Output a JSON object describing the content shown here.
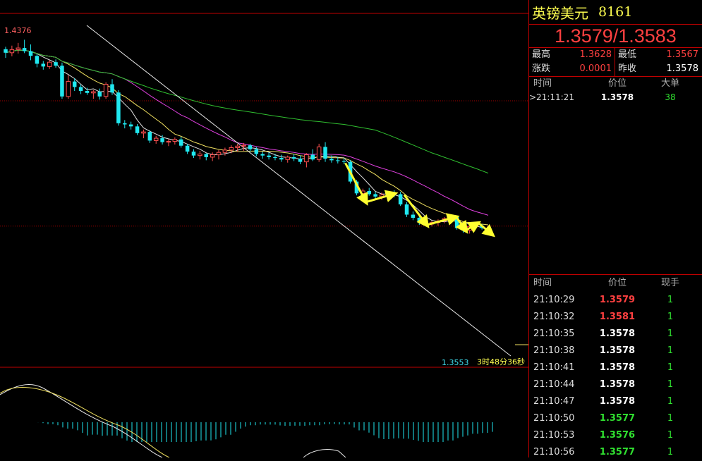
{
  "panel": {
    "name": "英镑美元",
    "code": "8161",
    "price": "1.3579/1.3583",
    "stats": {
      "high_label": "最高",
      "high": "1.3628",
      "low_label": "最低",
      "low": "1.3567",
      "change_label": "涨跌",
      "change": "0.0001",
      "prev_label": "昨收",
      "prev": "1.3578"
    },
    "big_orders": {
      "headers": [
        "时间",
        "价位",
        "大单"
      ],
      "rows": [
        {
          "time": ">21:11:21",
          "price": "1.3578",
          "qty": "38"
        }
      ]
    },
    "ticks": {
      "headers": [
        "时间",
        "价位",
        "现手"
      ],
      "rows": [
        {
          "time": "21:10:29",
          "price": "1.3579",
          "qty": "1",
          "color": "red"
        },
        {
          "time": "21:10:32",
          "price": "1.3581",
          "qty": "1",
          "color": "red"
        },
        {
          "time": "21:10:35",
          "price": "1.3578",
          "qty": "1",
          "color": "white"
        },
        {
          "time": "21:10:38",
          "price": "1.3578",
          "qty": "1",
          "color": "white"
        },
        {
          "time": "21:10:41",
          "price": "1.3578",
          "qty": "1",
          "color": "white"
        },
        {
          "time": "21:10:44",
          "price": "1.3578",
          "qty": "1",
          "color": "white"
        },
        {
          "time": "21:10:47",
          "price": "1.3578",
          "qty": "1",
          "color": "white"
        },
        {
          "time": "21:10:50",
          "price": "1.3577",
          "qty": "1",
          "color": "green"
        },
        {
          "time": "21:10:53",
          "price": "1.3576",
          "qty": "1",
          "color": "green"
        },
        {
          "time": "21:10:56",
          "price": "1.3577",
          "qty": "1",
          "color": "green"
        }
      ]
    }
  },
  "chart_data": {
    "type": "candlestick",
    "high_label": "1.4376",
    "low_label": "1.3553",
    "countdown": "3时48分36秒",
    "y_range": [
      1.3553,
      1.4376
    ],
    "grid_levels": [
      1.4215,
      1.3897
    ],
    "colors": {
      "up": "#ff5050",
      "down": "#20e8f0",
      "ma_white": "#e0e0e0",
      "ma_yellow": "#f0e060",
      "ma_magenta": "#e040e0",
      "ma_green": "#30c030",
      "arrow": "#ffff30",
      "grid": "#a00000",
      "frame": "#c00000"
    },
    "candles": [
      {
        "o": 1.4346,
        "h": 1.4352,
        "l": 1.4324,
        "c": 1.4337
      },
      {
        "o": 1.4337,
        "h": 1.4355,
        "l": 1.4328,
        "c": 1.4345
      },
      {
        "o": 1.4345,
        "h": 1.4362,
        "l": 1.4335,
        "c": 1.4349
      },
      {
        "o": 1.4349,
        "h": 1.437,
        "l": 1.4336,
        "c": 1.4341
      },
      {
        "o": 1.4341,
        "h": 1.4358,
        "l": 1.4318,
        "c": 1.4329
      },
      {
        "o": 1.4329,
        "h": 1.4334,
        "l": 1.43,
        "c": 1.4309
      },
      {
        "o": 1.4309,
        "h": 1.4316,
        "l": 1.4294,
        "c": 1.4302
      },
      {
        "o": 1.4302,
        "h": 1.4318,
        "l": 1.4296,
        "c": 1.4313
      },
      {
        "o": 1.4313,
        "h": 1.432,
        "l": 1.4299,
        "c": 1.4304
      },
      {
        "o": 1.4304,
        "h": 1.4312,
        "l": 1.422,
        "c": 1.4226
      },
      {
        "o": 1.4226,
        "h": 1.428,
        "l": 1.422,
        "c": 1.4264
      },
      {
        "o": 1.4264,
        "h": 1.4272,
        "l": 1.424,
        "c": 1.425
      },
      {
        "o": 1.425,
        "h": 1.4256,
        "l": 1.4232,
        "c": 1.424
      },
      {
        "o": 1.424,
        "h": 1.4248,
        "l": 1.423,
        "c": 1.4235
      },
      {
        "o": 1.4235,
        "h": 1.4242,
        "l": 1.422,
        "c": 1.4238
      },
      {
        "o": 1.4238,
        "h": 1.4246,
        "l": 1.4218,
        "c": 1.4226
      },
      {
        "o": 1.4226,
        "h": 1.4262,
        "l": 1.422,
        "c": 1.4257
      },
      {
        "o": 1.4257,
        "h": 1.427,
        "l": 1.423,
        "c": 1.4236
      },
      {
        "o": 1.4236,
        "h": 1.4242,
        "l": 1.4152,
        "c": 1.4158
      },
      {
        "o": 1.4158,
        "h": 1.4166,
        "l": 1.4145,
        "c": 1.4155
      },
      {
        "o": 1.4155,
        "h": 1.4162,
        "l": 1.4142,
        "c": 1.415
      },
      {
        "o": 1.415,
        "h": 1.4156,
        "l": 1.4128,
        "c": 1.4133
      },
      {
        "o": 1.4133,
        "h": 1.4142,
        "l": 1.412,
        "c": 1.4136
      },
      {
        "o": 1.4136,
        "h": 1.414,
        "l": 1.4108,
        "c": 1.4114
      },
      {
        "o": 1.4114,
        "h": 1.4126,
        "l": 1.4106,
        "c": 1.412
      },
      {
        "o": 1.412,
        "h": 1.4128,
        "l": 1.4104,
        "c": 1.411
      },
      {
        "o": 1.411,
        "h": 1.4118,
        "l": 1.41,
        "c": 1.4112
      },
      {
        "o": 1.4112,
        "h": 1.4122,
        "l": 1.4104,
        "c": 1.4117
      },
      {
        "o": 1.4117,
        "h": 1.4124,
        "l": 1.4096,
        "c": 1.4101
      },
      {
        "o": 1.4101,
        "h": 1.4106,
        "l": 1.408,
        "c": 1.4086
      },
      {
        "o": 1.4086,
        "h": 1.4092,
        "l": 1.407,
        "c": 1.4076
      },
      {
        "o": 1.4076,
        "h": 1.4088,
        "l": 1.4066,
        "c": 1.408
      },
      {
        "o": 1.408,
        "h": 1.4082,
        "l": 1.4064,
        "c": 1.4072
      },
      {
        "o": 1.4072,
        "h": 1.4084,
        "l": 1.4062,
        "c": 1.4078
      },
      {
        "o": 1.4078,
        "h": 1.409,
        "l": 1.4066,
        "c": 1.4084
      },
      {
        "o": 1.4084,
        "h": 1.4096,
        "l": 1.4076,
        "c": 1.409
      },
      {
        "o": 1.409,
        "h": 1.4102,
        "l": 1.4082,
        "c": 1.4096
      },
      {
        "o": 1.4096,
        "h": 1.4106,
        "l": 1.4086,
        "c": 1.41
      },
      {
        "o": 1.41,
        "h": 1.4108,
        "l": 1.4088,
        "c": 1.4102
      },
      {
        "o": 1.4102,
        "h": 1.4106,
        "l": 1.4086,
        "c": 1.4092
      },
      {
        "o": 1.4092,
        "h": 1.4098,
        "l": 1.4074,
        "c": 1.408
      },
      {
        "o": 1.408,
        "h": 1.4086,
        "l": 1.4068,
        "c": 1.4076
      },
      {
        "o": 1.4076,
        "h": 1.4084,
        "l": 1.4066,
        "c": 1.4072
      },
      {
        "o": 1.4072,
        "h": 1.408,
        "l": 1.4064,
        "c": 1.407
      },
      {
        "o": 1.407,
        "h": 1.4078,
        "l": 1.406,
        "c": 1.4066
      },
      {
        "o": 1.4066,
        "h": 1.4076,
        "l": 1.4058,
        "c": 1.4072
      },
      {
        "o": 1.4072,
        "h": 1.408,
        "l": 1.4062,
        "c": 1.4068
      },
      {
        "o": 1.4068,
        "h": 1.4076,
        "l": 1.4054,
        "c": 1.406
      },
      {
        "o": 1.406,
        "h": 1.4082,
        "l": 1.4046,
        "c": 1.4078
      },
      {
        "o": 1.4078,
        "h": 1.4092,
        "l": 1.4062,
        "c": 1.4066
      },
      {
        "o": 1.4066,
        "h": 1.4106,
        "l": 1.406,
        "c": 1.4098
      },
      {
        "o": 1.4098,
        "h": 1.411,
        "l": 1.406,
        "c": 1.4068
      },
      {
        "o": 1.4068,
        "h": 1.4076,
        "l": 1.4058,
        "c": 1.4064
      },
      {
        "o": 1.4064,
        "h": 1.4072,
        "l": 1.4056,
        "c": 1.4062
      },
      {
        "o": 1.4062,
        "h": 1.407,
        "l": 1.4054,
        "c": 1.406
      },
      {
        "o": 1.406,
        "h": 1.4064,
        "l": 1.4005,
        "c": 1.401
      },
      {
        "o": 1.401,
        "h": 1.4014,
        "l": 1.3975,
        "c": 1.398
      },
      {
        "o": 1.398,
        "h": 1.3992,
        "l": 1.3972,
        "c": 1.3986
      },
      {
        "o": 1.3986,
        "h": 1.3994,
        "l": 1.3974,
        "c": 1.3978
      },
      {
        "o": 1.3978,
        "h": 1.3984,
        "l": 1.3966,
        "c": 1.3972
      },
      {
        "o": 1.3972,
        "h": 1.3982,
        "l": 1.3964,
        "c": 1.3976
      },
      {
        "o": 1.3976,
        "h": 1.3986,
        "l": 1.397,
        "c": 1.398
      },
      {
        "o": 1.398,
        "h": 1.3988,
        "l": 1.397,
        "c": 1.3978
      },
      {
        "o": 1.3978,
        "h": 1.3984,
        "l": 1.3948,
        "c": 1.3952
      },
      {
        "o": 1.3952,
        "h": 1.3958,
        "l": 1.392,
        "c": 1.3926
      },
      {
        "o": 1.3926,
        "h": 1.3934,
        "l": 1.3912,
        "c": 1.3918
      },
      {
        "o": 1.3918,
        "h": 1.3924,
        "l": 1.39,
        "c": 1.3906
      },
      {
        "o": 1.3906,
        "h": 1.3912,
        "l": 1.3898,
        "c": 1.3902
      },
      {
        "o": 1.3902,
        "h": 1.391,
        "l": 1.3896,
        "c": 1.3906
      },
      {
        "o": 1.3906,
        "h": 1.3914,
        "l": 1.3898,
        "c": 1.391
      },
      {
        "o": 1.391,
        "h": 1.392,
        "l": 1.3904,
        "c": 1.3916
      },
      {
        "o": 1.3916,
        "h": 1.3926,
        "l": 1.3906,
        "c": 1.392
      },
      {
        "o": 1.392,
        "h": 1.3924,
        "l": 1.3888,
        "c": 1.3892
      },
      {
        "o": 1.3892,
        "h": 1.3898,
        "l": 1.388,
        "c": 1.3886
      },
      {
        "o": 1.3886,
        "h": 1.39,
        "l": 1.3878,
        "c": 1.3896
      },
      {
        "o": 1.3896,
        "h": 1.3904,
        "l": 1.389,
        "c": 1.3898
      },
      {
        "o": 1.3898,
        "h": 1.3902,
        "l": 1.3888,
        "c": 1.3892
      },
      {
        "o": 1.3892,
        "h": 1.3896,
        "l": 1.388,
        "c": 1.3885
      }
    ]
  }
}
